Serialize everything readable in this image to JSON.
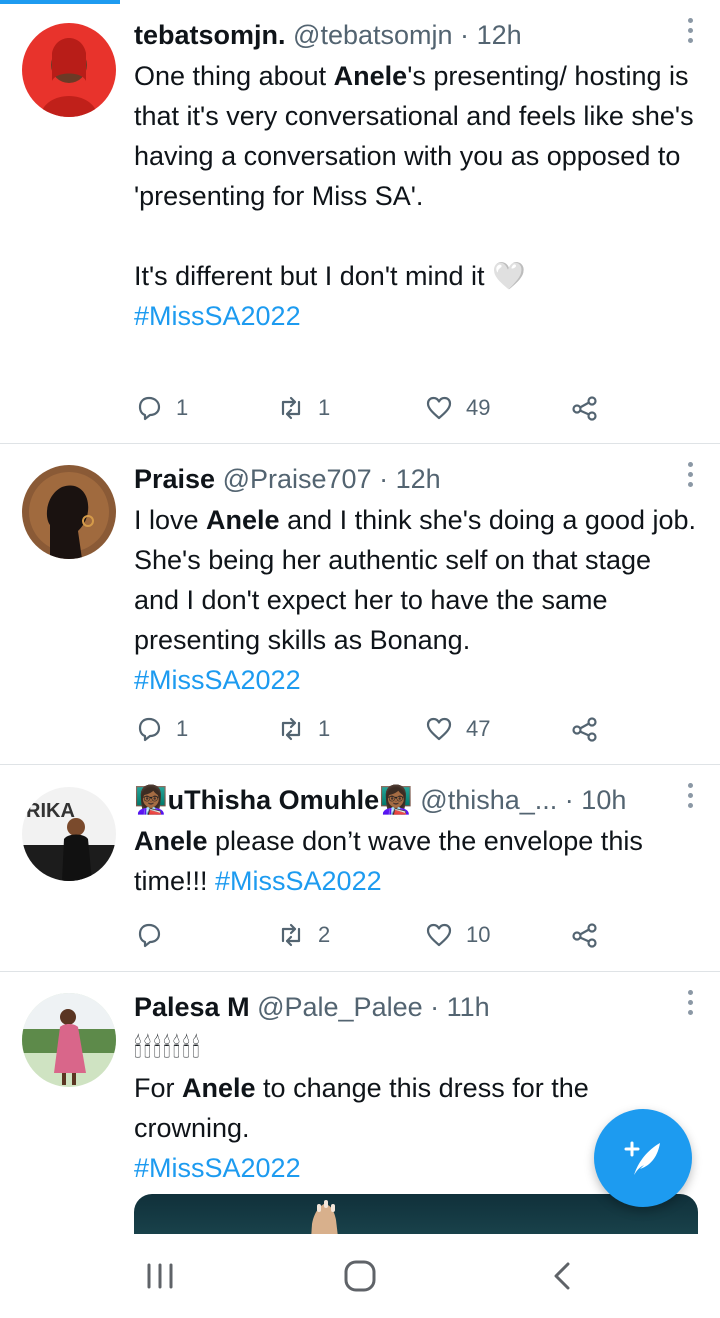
{
  "tweets": [
    {
      "name": "tebatsomjn.",
      "handle": "@tebatsomjn",
      "time": "12h",
      "text": {
        "pre": "One thing about ",
        "hl": "Anele",
        "post": "'s presenting/ hosting is that it's very conversational and feels like she's having a conversation with you as opposed to 'presenting for Miss SA'.",
        "line2": "It's different but I don't mind it 🤍",
        "tag": "#MissSA2022"
      },
      "replies": "1",
      "retweets": "1",
      "likes": "49"
    },
    {
      "name": "Praise",
      "handle": "@Praise707",
      "time": "12h",
      "text": {
        "pre": "I love ",
        "hl": "Anele",
        "post": " and I think she's doing a good job. She's being her authentic self on that stage and I don't expect her to have the same presenting skills as Bonang.",
        "tag": "#MissSA2022"
      },
      "replies": "1",
      "retweets": "1",
      "likes": "47"
    },
    {
      "name": "👩🏾‍🏫uThisha Omuhle👩🏾‍🏫",
      "handle": "@thisha_...",
      "time": "10h",
      "avatar_text": "RIKA",
      "text": {
        "hl": "Anele",
        "post": " please don’t wave the envelope this time!!! ",
        "tag": "#MissSA2022"
      },
      "replies": "",
      "retweets": "2",
      "likes": "10"
    },
    {
      "name": "Palesa M",
      "handle": "@Pale_Palee",
      "time": "11h",
      "text": {
        "candles": "🕯🕯🕯🕯🕯🕯🕯",
        "pre": "For ",
        "hl": "Anele",
        "post": " to change this dress for the crowning.",
        "tag": "#MissSA2022"
      }
    }
  ],
  "separator": "·",
  "colors": {
    "accent": "#1d9bf0",
    "text": "#0f1419",
    "muted": "#536471"
  },
  "icons": [
    "reply-icon",
    "retweet-icon",
    "like-icon",
    "share-icon",
    "compose-icon",
    "more-icon",
    "recents-icon",
    "home-icon",
    "back-icon"
  ]
}
